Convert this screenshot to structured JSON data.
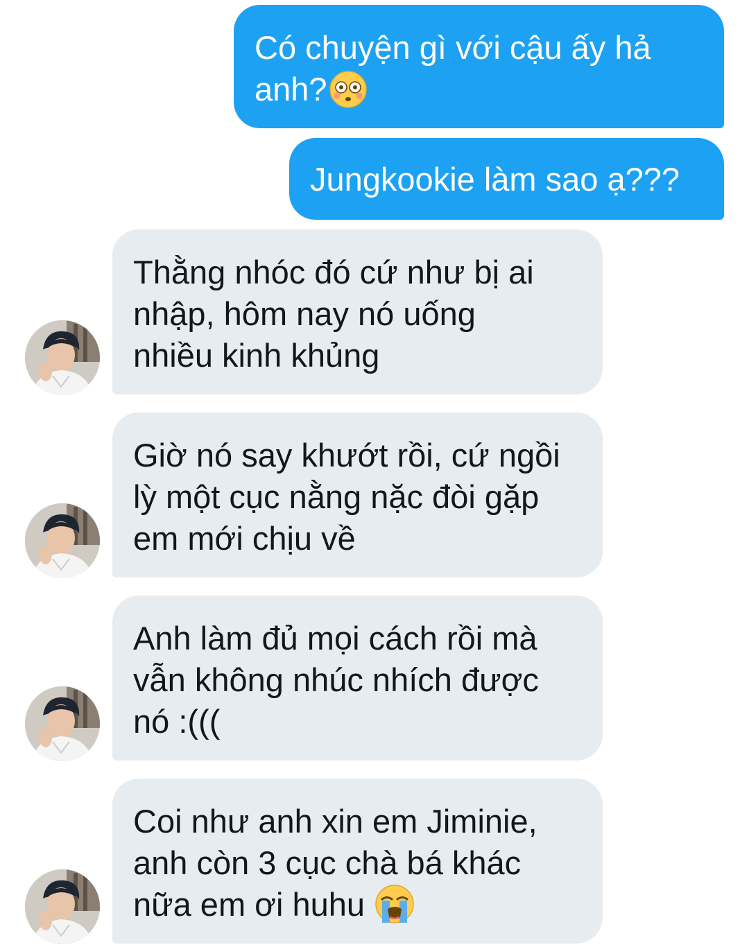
{
  "messages": [
    {
      "direction": "sent",
      "lines": [
        "Có chuyện gì với cậu ấy hả",
        "anh?"
      ],
      "trailing_emoji": "flushed-face"
    },
    {
      "direction": "sent",
      "lines": [
        "Jungkookie làm sao ạ???"
      ]
    },
    {
      "direction": "received",
      "lines": [
        "Thằng nhóc đó cứ như bị ai",
        "nhập, hôm nay nó uống",
        "nhiều kinh khủng"
      ],
      "avatar": "profile-photo"
    },
    {
      "direction": "received",
      "lines": [
        "Giờ nó say khướt rồi, cứ ngồi",
        "lỳ một cục nằng nặc đòi gặp",
        "em mới chịu về"
      ],
      "avatar": "profile-photo"
    },
    {
      "direction": "received",
      "lines": [
        "Anh làm đủ mọi cách rồi mà",
        "vẫn không nhúc nhích được",
        "nó :((("
      ],
      "avatar": "profile-photo"
    },
    {
      "direction": "received",
      "lines": [
        "Coi như anh xin em Jiminie,",
        "anh còn 3 cục chà bá khác",
        "nữa em ơi huhu"
      ],
      "trailing_emoji": "loudly-crying-face",
      "avatar": "profile-photo"
    }
  ],
  "colors": {
    "sent_bubble": "#1da1f2",
    "received_bubble": "#e6ecf0",
    "received_text": "#14171a",
    "sent_text": "#ffffff"
  }
}
